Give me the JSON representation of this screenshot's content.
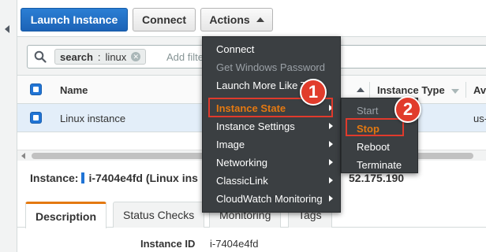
{
  "toolbar": {
    "launch_label": "Launch Instance",
    "connect_label": "Connect",
    "actions_label": "Actions"
  },
  "search": {
    "token_key": "search",
    "token_sep": ":",
    "token_value": "linux",
    "placeholder": "Add filter"
  },
  "table": {
    "columns": [
      "Name",
      "Instance Type",
      "Av"
    ],
    "rows": [
      {
        "name": "Linux instance",
        "az": "us-"
      }
    ]
  },
  "details": {
    "label": "Instance:",
    "instance_id_text": "i-7404e4fd (Linux ins",
    "ip_fragment": "52.175.190",
    "tabs": [
      "Description",
      "Status Checks",
      "Monitoring",
      "Tags"
    ],
    "field_label": "Instance ID",
    "field_value": "i-7404e4fd"
  },
  "actions_menu": {
    "items": [
      {
        "label": "Connect",
        "disabled": false,
        "submenu": false
      },
      {
        "label": "Get Windows Password",
        "disabled": true,
        "submenu": false
      },
      {
        "label": "Launch More Like This",
        "disabled": false,
        "submenu": false
      },
      {
        "label": "Instance State",
        "disabled": false,
        "submenu": true,
        "highlighted": true
      },
      {
        "label": "Instance Settings",
        "disabled": false,
        "submenu": true
      },
      {
        "label": "Image",
        "disabled": false,
        "submenu": true
      },
      {
        "label": "Networking",
        "disabled": false,
        "submenu": true
      },
      {
        "label": "ClassicLink",
        "disabled": false,
        "submenu": true
      },
      {
        "label": "CloudWatch Monitoring",
        "disabled": false,
        "submenu": true
      }
    ]
  },
  "state_menu": {
    "items": [
      {
        "label": "Start",
        "disabled": true
      },
      {
        "label": "Stop",
        "disabled": false,
        "highlighted": true
      },
      {
        "label": "Reboot",
        "disabled": false
      },
      {
        "label": "Terminate",
        "disabled": false
      }
    ]
  },
  "badges": [
    "1",
    "2"
  ],
  "colors": {
    "primary": "#1c63b6",
    "menu_bg": "#3b3f42",
    "highlight_orange": "#e47911",
    "annotation_red": "#e03a2c",
    "selected_row": "#e3eef9"
  }
}
